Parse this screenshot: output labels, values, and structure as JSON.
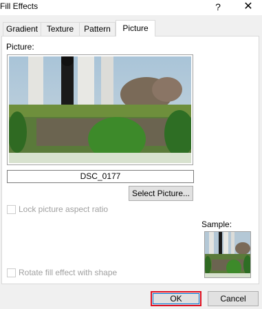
{
  "window": {
    "title": "Fill Effects",
    "help_glyph": "?",
    "close_glyph": "✕"
  },
  "tabs": [
    {
      "label": "Gradient",
      "active": false
    },
    {
      "label": "Texture",
      "active": false
    },
    {
      "label": "Pattern",
      "active": false
    },
    {
      "label": "Picture",
      "active": true
    }
  ],
  "picture_panel": {
    "picture_label": "Picture:",
    "filename": "DSC_0177",
    "select_button": "Select Picture...",
    "lock_aspect_label": "Lock picture aspect ratio",
    "lock_aspect_checked": false,
    "lock_aspect_enabled": false,
    "sample_label": "Sample:",
    "rotate_label": "Rotate fill effect with shape",
    "rotate_checked": false,
    "rotate_enabled": false
  },
  "footer": {
    "ok_label": "OK",
    "cancel_label": "Cancel"
  },
  "colors": {
    "dialog_bg": "#f0f0f0",
    "panel_bg": "#ffffff",
    "highlight_red": "#e01020",
    "focus_blue": "#0078d7",
    "disabled_text": "#a0a0a0"
  },
  "icons": {
    "help": "help-icon",
    "close": "close-icon"
  }
}
